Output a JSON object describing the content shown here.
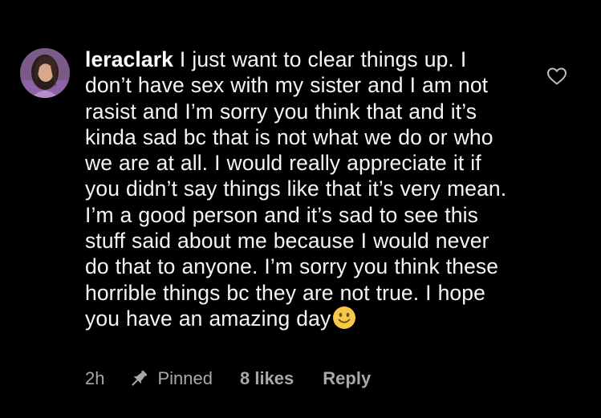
{
  "comment": {
    "username": "leraclark",
    "text": "I just want to clear things up. I don’t have sex with my sister and I am not rasist and I’m sorry you think that and it’s kinda sad bc that is not what we do or who we are at all. I would really appreciate it if you didn’t say things like that it’s very mean. I’m a good person and it’s sad to see this stuff said about me because I would never do that to anyone. I’m sorry you think these horrible things bc they are not true. I hope you have an amazing day",
    "emoji": "slightly-smiling-face"
  },
  "meta": {
    "time": "2h",
    "pinned_label": "Pinned",
    "likes": "8 likes",
    "reply_label": "Reply"
  },
  "icons": {
    "like": "heart-outline-icon",
    "pin": "pin-icon"
  },
  "colors": {
    "background": "#000000",
    "text": "#f5f5f5",
    "meta_text": "#a8a8a8",
    "emoji": "#f7c948"
  }
}
